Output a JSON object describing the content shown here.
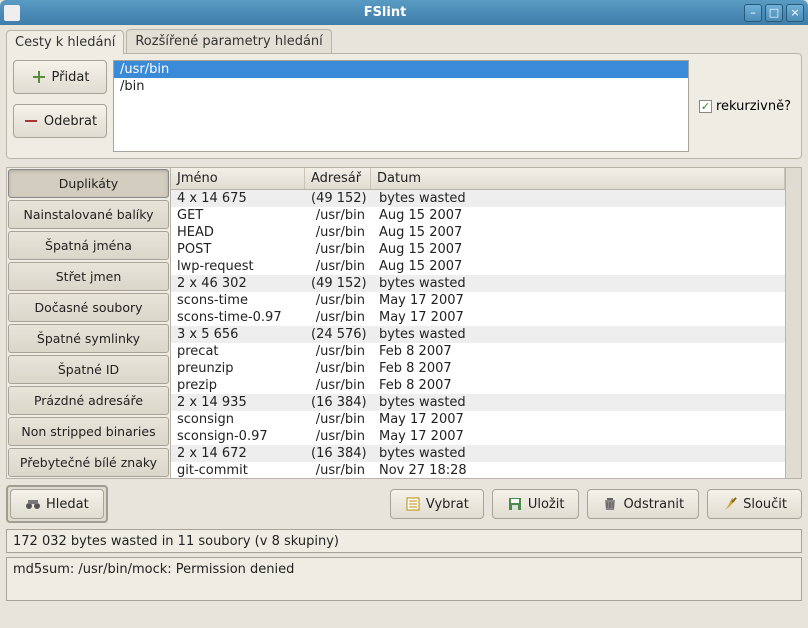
{
  "window": {
    "title": "FSlint"
  },
  "tabs": {
    "paths": "Cesty k hledání",
    "advanced": "Rozšířené parametry hledání"
  },
  "buttons": {
    "add": "Přidat",
    "remove": "Odebrat",
    "search": "Hledat",
    "select": "Vybrat",
    "save": "Uložit",
    "delete": "Odstranit",
    "merge": "Sloučit"
  },
  "recurse_label": "rekurzivně?",
  "paths": [
    "/usr/bin",
    "/bin"
  ],
  "sidebar": [
    "Duplikáty",
    "Nainstalované balíky",
    "Špatná jména",
    "Střet jmen",
    "Dočasné soubory",
    "Špatné symlinky",
    "Špatné ID",
    "Prázdné adresáře",
    "Non stripped binaries",
    "Přebytečné bílé znaky"
  ],
  "columns": {
    "name": "Jméno",
    "dir": "Adresář",
    "date": "Datum"
  },
  "rows": [
    {
      "g": true,
      "name": "4 x 14 675",
      "dir": "(49 152)",
      "date": "bytes wasted"
    },
    {
      "g": false,
      "name": "GET",
      "dir": "/usr/bin",
      "date": "Aug 15 2007"
    },
    {
      "g": false,
      "name": "HEAD",
      "dir": "/usr/bin",
      "date": "Aug 15 2007"
    },
    {
      "g": false,
      "name": "POST",
      "dir": "/usr/bin",
      "date": "Aug 15 2007"
    },
    {
      "g": false,
      "name": "lwp-request",
      "dir": "/usr/bin",
      "date": "Aug 15 2007"
    },
    {
      "g": true,
      "name": "2 x 46 302",
      "dir": "(49 152)",
      "date": "bytes wasted"
    },
    {
      "g": false,
      "name": "scons-time",
      "dir": "/usr/bin",
      "date": "May 17 2007"
    },
    {
      "g": false,
      "name": "scons-time-0.97",
      "dir": "/usr/bin",
      "date": "May 17 2007"
    },
    {
      "g": true,
      "name": "3 x 5 656",
      "dir": "(24 576)",
      "date": "bytes wasted"
    },
    {
      "g": false,
      "name": "precat",
      "dir": "/usr/bin",
      "date": "Feb  8 2007"
    },
    {
      "g": false,
      "name": "preunzip",
      "dir": "/usr/bin",
      "date": "Feb  8 2007"
    },
    {
      "g": false,
      "name": "prezip",
      "dir": "/usr/bin",
      "date": "Feb  8 2007"
    },
    {
      "g": true,
      "name": "2 x 14 935",
      "dir": "(16 384)",
      "date": "bytes wasted"
    },
    {
      "g": false,
      "name": "sconsign",
      "dir": "/usr/bin",
      "date": "May 17 2007"
    },
    {
      "g": false,
      "name": "sconsign-0.97",
      "dir": "/usr/bin",
      "date": "May 17 2007"
    },
    {
      "g": true,
      "name": "2 x 14 672",
      "dir": "(16 384)",
      "date": "bytes wasted"
    },
    {
      "g": false,
      "name": "git-commit",
      "dir": "/usr/bin",
      "date": "Nov 27 18:28"
    }
  ],
  "status": "172 032 bytes wasted in 11 soubory (v 8 skupiny)",
  "log": "md5sum: /usr/bin/mock: Permission denied"
}
